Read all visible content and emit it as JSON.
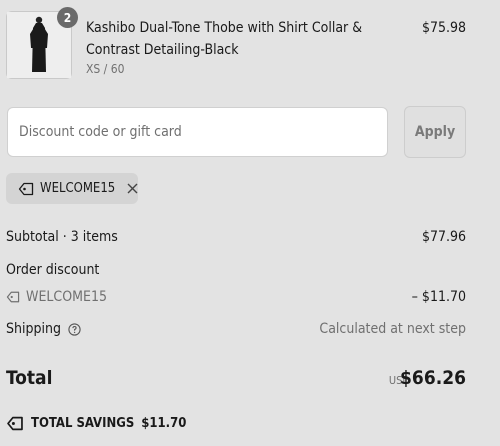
{
  "cart_item": {
    "name": "Kashibo Dual-Tone Thobe with Shirt Collar & Contrast Detailing-Black",
    "variant": "XS / 60",
    "price": "$75.98",
    "quantity": "2",
    "image_icon": "product-thumbnail"
  },
  "discount": {
    "placeholder": "Discount code or gift card",
    "apply_label": "Apply",
    "applied_code": "WELCOME15"
  },
  "summary": {
    "subtotal_label": "Subtotal · 3 items",
    "subtotal_value": "$77.96",
    "order_discount_label": "Order discount",
    "discount_code": "WELCOME15",
    "discount_value": "– $11.70",
    "shipping_label": "Shipping",
    "shipping_value": "Calculated at next step",
    "total_label": "Total",
    "currency": "USD",
    "total_value": "$66.26",
    "savings_label": "TOTAL SAVINGS",
    "savings_value": "$11.70"
  }
}
